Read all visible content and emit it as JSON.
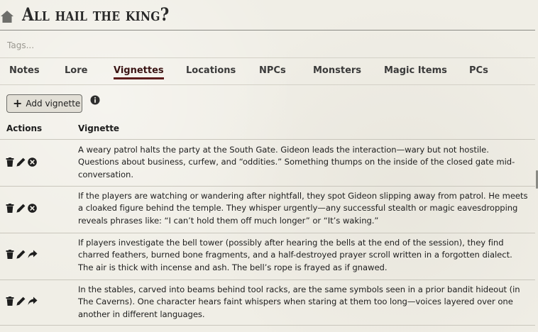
{
  "page": {
    "title": "All hail the king?",
    "tags_placeholder": "Tags..."
  },
  "tabs": [
    {
      "label": "Notes",
      "active": false
    },
    {
      "label": "Lore",
      "active": false
    },
    {
      "label": "Vignettes",
      "active": true
    },
    {
      "label": "Locations",
      "active": false
    },
    {
      "label": "NPCs",
      "active": false
    },
    {
      "label": "Monsters",
      "active": false
    },
    {
      "label": "Magic Items",
      "active": false
    },
    {
      "label": "PCs",
      "active": false
    }
  ],
  "toolbar": {
    "add_label": "Add vignette",
    "add_icon": "plus-icon",
    "info_icon": "info-icon"
  },
  "table": {
    "headers": {
      "actions": "Actions",
      "vignette": "Vignette"
    },
    "rows": [
      {
        "text": "A weary patrol halts the party at the South Gate. Gideon leads the interaction—wary but not hostile. Questions about business, curfew, and “oddities.” Something thumps on the inside of the closed gate mid-conversation.",
        "actions": [
          "trash-icon",
          "pencil-icon",
          "remove-circle-icon"
        ]
      },
      {
        "text": "If the players are watching or wandering after nightfall, they spot Gideon slipping away from patrol. He meets a cloaked figure behind the temple. They whisper urgently—any successful stealth or magic eavesdropping reveals phrases like: “I can’t hold them off much longer” or “It’s waking.”",
        "actions": [
          "trash-icon",
          "pencil-icon",
          "remove-circle-icon"
        ]
      },
      {
        "text": "If players investigate the bell tower (possibly after hearing the bells at the end of the session), they find charred feathers, burned bone fragments, and a half-destroyed prayer scroll written in a forgotten dialect. The air is thick with incense and ash. The bell’s rope is frayed as if gnawed.",
        "actions": [
          "trash-icon",
          "pencil-icon",
          "share-arrow-icon"
        ]
      },
      {
        "text": "In the stables, carved into beams behind tool racks, are the same symbols seen in a prior bandit hideout (in The Caverns). One character hears faint whispers when staring at them too long—voices layered over one another in different languages.",
        "actions": [
          "trash-icon",
          "pencil-icon",
          "share-arrow-icon"
        ]
      }
    ]
  },
  "colors": {
    "background": "#f0eee6",
    "active_tab_underline": "#5c1c1c",
    "text": "#1e1e1e"
  }
}
